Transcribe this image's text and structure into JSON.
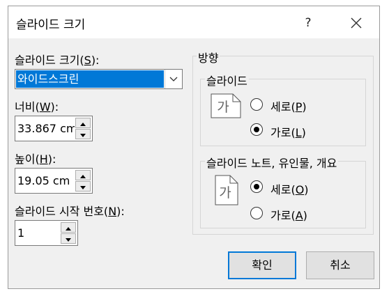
{
  "window": {
    "title": "슬라이드 크기",
    "help": "?"
  },
  "left": {
    "size_label": "슬라이드 크기(",
    "size_key": "S",
    "size_tail": "):",
    "size_value": "와이드스크린",
    "width_label": "너비(",
    "width_key": "W",
    "width_tail": "):",
    "width_value": "33.867 cm",
    "height_label": "높이(",
    "height_key": "H",
    "height_tail": "):",
    "height_value": "19.05 cm",
    "start_label": "슬라이드 시작 번호(",
    "start_key": "N",
    "start_tail": "):",
    "start_value": "1"
  },
  "orientation": {
    "title": "방향",
    "slides": {
      "title": "슬라이드",
      "icon_glyph": "가",
      "portrait_label": "세로(",
      "portrait_key": "P",
      "landscape_label": "가로(",
      "landscape_key": "L",
      "selected": "landscape"
    },
    "notes": {
      "title": "슬라이드 노트, 유인물, 개요",
      "icon_glyph": "가",
      "portrait_label": "세로(",
      "portrait_key": "O",
      "landscape_label": "가로(",
      "landscape_key": "A",
      "selected": "portrait"
    },
    "close_paren": ")"
  },
  "buttons": {
    "ok": "확인",
    "cancel": "취소"
  }
}
